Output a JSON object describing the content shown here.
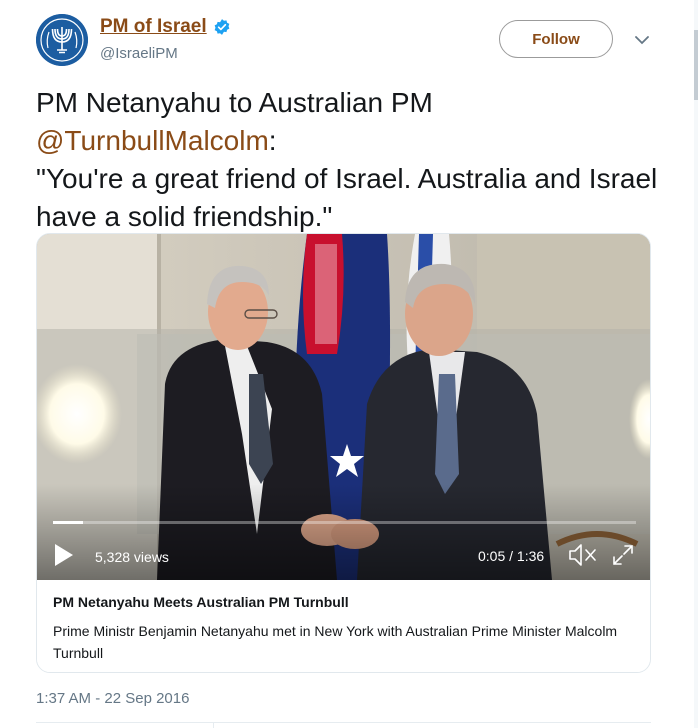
{
  "account": {
    "display_name": "PM of Israel",
    "handle": "@IsraeliPM",
    "verified": true
  },
  "header": {
    "follow_label": "Follow"
  },
  "tweet": {
    "text_before_mention": "PM Netanyahu to Australian PM",
    "mention": "@TurnbullMalcolm",
    "text_after_mention": ":",
    "quote": "\"You're a great friend of Israel. Australia and Israel have a solid friendship.\"",
    "timestamp": "1:37 AM - 22 Sep 2016"
  },
  "video": {
    "views": "5,328 views",
    "time": "0:05 / 1:36",
    "progress_fraction": 0.052
  },
  "card": {
    "title": "PM Netanyahu Meets Australian PM Turnbull",
    "description": "Prime Ministr Benjamin Netanyahu met in New York with Australian Prime Minister Malcolm Turnbull"
  },
  "colors": {
    "link": "#8a4b17",
    "verified_badge": "#1da1f2",
    "secondary_text": "#657786",
    "border": "#e1e8ed"
  },
  "icons": [
    "israel-emblem-avatar",
    "verified-icon",
    "chevron-down-icon",
    "play-icon",
    "mute-icon",
    "fullscreen-icon"
  ]
}
